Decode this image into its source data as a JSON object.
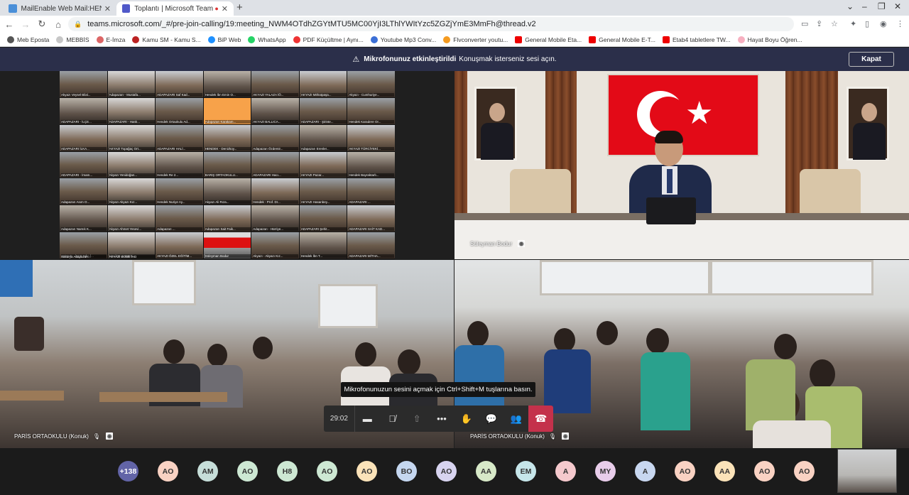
{
  "browser": {
    "tabs": [
      {
        "title": "MailEnable Web Mail:HENDEKS...",
        "icon": "mail-icon",
        "color": "#4a8fd8"
      },
      {
        "title": "Toplantı | Microsoft Teams",
        "icon": "teams-icon",
        "color": "#5059c9"
      }
    ],
    "url": "teams.microsoft.com/_#/pre-join-calling/19:meeting_NWM4OTdhZGYtMTU5MC00YjI3LThlYWItYzc5ZGZjYmE3MmFh@thread.v2",
    "bookmarks": [
      {
        "label": "Meb Eposta",
        "color": "#555"
      },
      {
        "label": "MEBBİS",
        "color": "#c7c7c7"
      },
      {
        "label": "E-İmza",
        "color": "#d66"
      },
      {
        "label": "Kamu SM - Kamu S...",
        "color": "#b22"
      },
      {
        "label": "BiP Web",
        "color": "#1e90ff"
      },
      {
        "label": "WhatsApp",
        "color": "#25d366"
      },
      {
        "label": "PDF Küçültme | Aynı...",
        "color": "#e33"
      },
      {
        "label": "Youtube Mp3 Conv...",
        "color": "#3b6fd6"
      },
      {
        "label": "Flvconverter youtu...",
        "color": "#f59b20"
      },
      {
        "label": "General Mobile Eta...",
        "color": "#e00"
      },
      {
        "label": "General Mobile E-T...",
        "color": "#e00"
      },
      {
        "label": "Etab4 tabletlere TW...",
        "color": "#e00"
      },
      {
        "label": "Hayat Boyu Öğren...",
        "color": "#f7b0c0"
      }
    ]
  },
  "notice": {
    "title": "Mikrofonunuz etkinleştirildi",
    "text": "Konuşmak isterseniz sesi açın.",
    "button": "Kapat"
  },
  "gallery_labels": [
    "Akyazı Veysel Bilal...",
    "Adapazarı - Mustafa...",
    "ADAPAZARI Saf Kad...",
    "Hendek İbn Emin O...",
    "AKYAZI YALAZA İÖ...",
    "AKYAZI Mithatpaşa...",
    "Akyazı - Cumhuriye...",
    "ADAPAZARI - İLÇE...",
    "ADAPAZARI - Hanlı...",
    "Hendek Ortaokulu Ad...",
    "Adapazarı Karakam...",
    "AKYAZI BALLICA...",
    "ADAPAZARI - Şirinte...",
    "Hendek Karadere Or...",
    "ADAPAZARI İLKA...",
    "AKYAZI Topağaç Ort...",
    "ADAPAZARI HALİ...",
    "HENDEK - Denizkoy...",
    "Adapazarı Özdemir...",
    "Adapazarı Erenler...",
    "AKYAZI TÜRCİYEKİ...",
    "ADAPAZARI - İmam...",
    "Akyazı Yenidoğan...",
    "Hendek Re 2...",
    "BARIŞ ORTAOKULU...",
    "ADAPAZARI Hacı...",
    "AKYAZI Pazar...",
    "Hendek Bayraktarlı...",
    "Adapazarı Asım O...",
    "Akyazı Akyazı Kız...",
    "Hendek Nuriye Ay...",
    "Akyazı Ali Rıza...",
    "Hendek - Prof. Dr...",
    "AKYAZI Hasanbey...",
    "ADAPAZARI ...",
    "Adapazarı Namık K...",
    "Akyazı Ahmet Yesevi...",
    "Adapazarı ...",
    "Adapazarı Sait Faik...",
    "Adapazarı - Hürriye...",
    "ADAPAZARI Şehit...",
    "ADAPAZARI SAİT KAD...",
    "AKYAZI - İLÇE MİLLİ...",
    "HALİDE AHMET...",
    "AKYAZI ÖZEL EĞİTİM...",
    "Süleyman Bodur",
    "Akyazı - Akyazı Kız...",
    "Hendek İbn T...",
    "ADAPAZARI MİTHA...",
    "Sakarya Adapazarı...",
    "AKYAZI BOBB İHO"
  ],
  "tiles": {
    "speaker_name": "Süleyman Bodur",
    "left_name": "PARİS ORTAOKULU (Konuk)",
    "right_name": "PARİS ORTAOKULU (Konuk)"
  },
  "tooltip": "Mikrofonunuzun sesini açmak için Ctrl+Shift+M tuşlarına basın.",
  "callbar": {
    "timer": "29:02",
    "buttons": [
      "camera-icon",
      "mic-off-icon",
      "share-icon",
      "more-icon",
      "raise-hand-icon",
      "chat-icon",
      "people-icon",
      "hangup-icon"
    ]
  },
  "participants": [
    {
      "initials": "+138",
      "color": "#6264a7",
      "text_color": "#ffffff"
    },
    {
      "initials": "AO",
      "color": "#f9d2c3"
    },
    {
      "initials": "AM",
      "color": "#c6ded9"
    },
    {
      "initials": "AO",
      "color": "#cde8d3"
    },
    {
      "initials": "H8",
      "color": "#cde8d3"
    },
    {
      "initials": "AO",
      "color": "#cde8d3"
    },
    {
      "initials": "AO",
      "color": "#fbe3b9"
    },
    {
      "initials": "BO",
      "color": "#c5d7f0"
    },
    {
      "initials": "AO",
      "color": "#d8d4f0"
    },
    {
      "initials": "AA",
      "color": "#d7e9c8"
    },
    {
      "initials": "EM",
      "color": "#c6e6ea"
    },
    {
      "initials": "A",
      "color": "#f5c9cd"
    },
    {
      "initials": "MY",
      "color": "#e8cdea"
    },
    {
      "initials": "A",
      "color": "#c8d7f0"
    },
    {
      "initials": "AO",
      "color": "#f9d2c3"
    },
    {
      "initials": "AA",
      "color": "#fbe3b9"
    },
    {
      "initials": "AO",
      "color": "#f9d2c3"
    },
    {
      "initials": "AO",
      "color": "#f9d2c3"
    }
  ]
}
